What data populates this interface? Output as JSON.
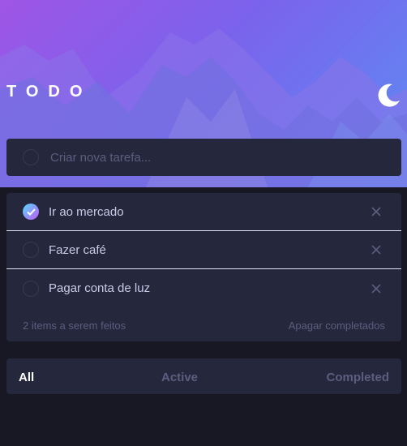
{
  "header": {
    "title": "TODO",
    "theme_icon": "moon-icon"
  },
  "new_todo": {
    "placeholder": "Criar nova tarefa..."
  },
  "todos": [
    {
      "label": "Ir ao mercado",
      "completed": true
    },
    {
      "label": "Fazer café",
      "completed": false
    },
    {
      "label": "Pagar conta de luz",
      "completed": false
    }
  ],
  "footer": {
    "items_left": "2 items a serem feitos",
    "clear_label": "Apagar completados"
  },
  "filters": {
    "all": "All",
    "active": "Active",
    "completed": "Completed",
    "selected": "All"
  },
  "colors": {
    "background": "#171823",
    "card": "#25273d",
    "text": "#c8cbe7",
    "muted": "#5b5e7e",
    "active_filter": "#ffffff",
    "check_gradient_start": "#55ddff",
    "check_gradient_end": "#c058f3"
  }
}
